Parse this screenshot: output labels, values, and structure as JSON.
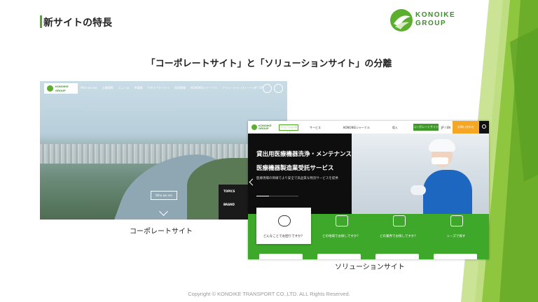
{
  "slide": {
    "title": "新サイトの特長",
    "heading": "「コーポレートサイト」と「ソリューションサイト」の分離",
    "footer": "Copyright © KONOIKE TRANSPORT CO.,LTD.  ALL Rights Reserved.",
    "logo_line1": "KONOIKE",
    "logo_line2": "GROUP",
    "accent_color": "#4caf22"
  },
  "corporate": {
    "caption": "コーポレートサイト",
    "logo_line1": "KONOIKE",
    "logo_line2": "GROUP",
    "menu": [
      "Who we are",
      "企業情報",
      "ニュース",
      "IR情報",
      "サステナビリティ",
      "採用情報",
      "KONOIKEジャーナル",
      "ソリューションストーリー"
    ],
    "lang": "JP / EN",
    "cta": "Who we are",
    "topics": "TOPICS",
    "brand": "BRAND"
  },
  "solution": {
    "caption": "ソリューションサイト",
    "logo_line1": "KONOIKE",
    "logo_line2": "GROUP",
    "tag": "ソリューションサイト",
    "menu": [
      "サービス",
      "KONOIKEジャーナル",
      "導入"
    ],
    "corp_button": "コーポレートサイト",
    "lang": "JP / EN",
    "contact": "お問い合わせ",
    "hero_line1": "貸出用医療機器洗浄・メンテナンス",
    "hero_line2": "医療機器製造業受託サービス",
    "hero_sub": "医療現場の目線でより安全で高品質な物流サービスを提供",
    "cards": [
      {
        "label": "どんなことでお困りですか？",
        "icon": "handshake-icon"
      },
      {
        "label": "どの地域でお探しですか？",
        "icon": "map-pin-icon"
      },
      {
        "label": "どの業界でお探しですか？",
        "icon": "building-icon"
      },
      {
        "label": "ニーズで探す",
        "icon": "document-icon"
      }
    ]
  }
}
